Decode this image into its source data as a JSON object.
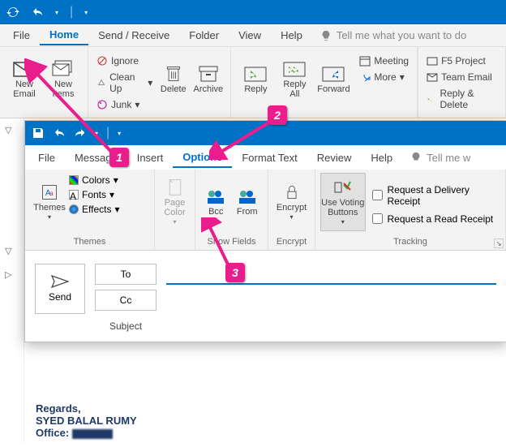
{
  "main": {
    "tabs": [
      "File",
      "Home",
      "Send / Receive",
      "Folder",
      "View",
      "Help"
    ],
    "active_tab": "Home",
    "tell_me": "Tell me what you want to do",
    "ribbon": {
      "new_email": "New\nEmail",
      "new_items": "New\nItems",
      "ignore": "Ignore",
      "clean_up": "Clean Up",
      "junk": "Junk",
      "delete": "Delete",
      "archive": "Archive",
      "reply": "Reply",
      "reply_all": "Reply\nAll",
      "forward": "Forward",
      "meeting": "Meeting",
      "more": "More",
      "f5_project": "F5 Project",
      "team_email": "Team Email",
      "reply_delete": "Reply & Delete"
    }
  },
  "compose": {
    "tabs": [
      "File",
      "Message",
      "Insert",
      "Options",
      "Format Text",
      "Review",
      "Help"
    ],
    "active_tab": "Options",
    "tell_me": "Tell me w",
    "groups": {
      "themes": {
        "label": "Themes",
        "themes_btn": "Themes",
        "colors": "Colors",
        "fonts": "Fonts",
        "effects": "Effects"
      },
      "page_color": "Page\nColor",
      "show_fields": {
        "label": "Show Fields",
        "bcc": "Bcc",
        "from": "From"
      },
      "encrypt": {
        "label": "Encrypt",
        "btn": "Encrypt"
      },
      "tracking": {
        "label": "Tracking",
        "voting": "Use Voting\nButtons",
        "delivery": "Request a Delivery Receipt",
        "read": "Request a Read Receipt"
      }
    },
    "send": "Send",
    "to": "To",
    "cc": "Cc",
    "subject": "Subject"
  },
  "body": {
    "regards": "Regards,",
    "name": "SYED BALAL RUMY",
    "office": "Office:"
  },
  "annotations": {
    "n1": "1",
    "n2": "2",
    "n3": "3"
  }
}
